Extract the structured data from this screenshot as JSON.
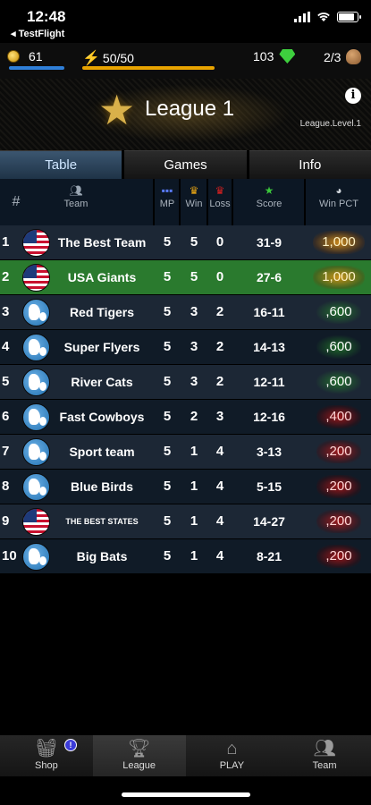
{
  "status_bar": {
    "time": "12:48",
    "back_label": "◂ TestFlight"
  },
  "resources": {
    "coins": "61",
    "energy": "50/50",
    "energy_fraction": 1.0,
    "gems": "103",
    "balls": "2/3"
  },
  "league": {
    "title": "League 1",
    "level_label": "League.Level.1"
  },
  "tabs": [
    {
      "label": "Table",
      "active": true
    },
    {
      "label": "Games",
      "active": false
    },
    {
      "label": "Info",
      "active": false
    }
  ],
  "table": {
    "headers": {
      "num": "#",
      "team": "Team",
      "mp": "MP",
      "win": "Win",
      "loss": "Loss",
      "score": "Score",
      "pct": "Win PCT"
    },
    "rows": [
      {
        "num": "1",
        "flag": "usa",
        "team": "The Best Team",
        "mp": "5",
        "win": "5",
        "loss": "0",
        "score": "31-9",
        "pct": "1,000",
        "pct_style": "gold"
      },
      {
        "num": "2",
        "flag": "usa",
        "team": "USA Giants",
        "mp": "5",
        "win": "5",
        "loss": "0",
        "score": "27-6",
        "pct": "1,000",
        "pct_style": "gold"
      },
      {
        "num": "3",
        "flag": "globe",
        "team": "Red Tigers",
        "mp": "5",
        "win": "3",
        "loss": "2",
        "score": "16-11",
        "pct": ",600",
        "pct_style": "green"
      },
      {
        "num": "4",
        "flag": "globe",
        "team": "Super Flyers",
        "mp": "5",
        "win": "3",
        "loss": "2",
        "score": "14-13",
        "pct": ",600",
        "pct_style": "green"
      },
      {
        "num": "5",
        "flag": "globe",
        "team": "River Cats",
        "mp": "5",
        "win": "3",
        "loss": "2",
        "score": "12-11",
        "pct": ",600",
        "pct_style": "green"
      },
      {
        "num": "6",
        "flag": "globe",
        "team": "Fast Cowboys",
        "mp": "5",
        "win": "2",
        "loss": "3",
        "score": "12-16",
        "pct": ",400",
        "pct_style": "red"
      },
      {
        "num": "7",
        "flag": "globe",
        "team": "Sport team",
        "mp": "5",
        "win": "1",
        "loss": "4",
        "score": "3-13",
        "pct": ",200",
        "pct_style": "red"
      },
      {
        "num": "8",
        "flag": "globe",
        "team": "Blue Birds",
        "mp": "5",
        "win": "1",
        "loss": "4",
        "score": "5-15",
        "pct": ",200",
        "pct_style": "red"
      },
      {
        "num": "9",
        "flag": "usa",
        "team": "THE BEST STATES",
        "mp": "5",
        "win": "1",
        "loss": "4",
        "score": "14-27",
        "pct": ",200",
        "pct_style": "red"
      },
      {
        "num": "10",
        "flag": "globe",
        "team": "Big Bats",
        "mp": "5",
        "win": "1",
        "loss": "4",
        "score": "8-21",
        "pct": ",200",
        "pct_style": "red"
      }
    ],
    "highlighted_row": 2
  },
  "bottom_nav": [
    {
      "label": "Shop",
      "icon": "basket-icon",
      "badge": "!"
    },
    {
      "label": "League",
      "icon": "trophy-icon",
      "active": true
    },
    {
      "label": "PLAY",
      "icon": "stadium-icon"
    },
    {
      "label": "Team",
      "icon": "players-icon"
    }
  ]
}
